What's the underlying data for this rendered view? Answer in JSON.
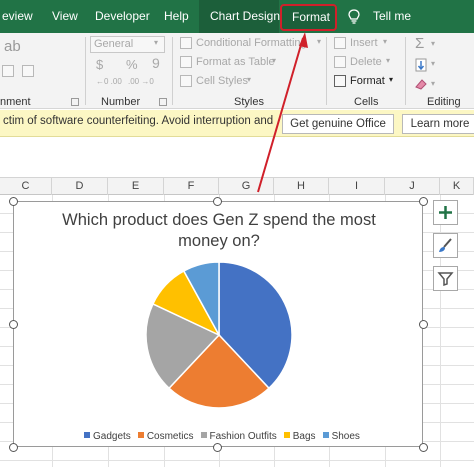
{
  "tabs": {
    "review": "eview",
    "view": "View",
    "developer": "Developer",
    "help": "Help",
    "chart_design": "Chart Design",
    "format": "Format",
    "tell_me": "Tell me"
  },
  "ribbon": {
    "number": {
      "format_select": "General",
      "currency": "$",
      "percent": "%",
      "comma": "9",
      "increase_decimal": "←0 .00",
      "decrease_decimal": ".00 →0",
      "label": "Number"
    },
    "alignment": {
      "label": "nment"
    },
    "styles": {
      "conditional_formatting": "Conditional Formatting",
      "format_as_table": "Format as Table",
      "cell_styles": "Cell Styles",
      "label": "Styles"
    },
    "cells": {
      "insert": "Insert",
      "delete": "Delete",
      "format": "Format",
      "label": "Cells"
    },
    "editing": {
      "label": "Editing"
    }
  },
  "message_bar": {
    "text": "ctim of software counterfeiting. Avoid interruption and",
    "genuine_button": "Get genuine Office",
    "learn_more_button": "Learn more"
  },
  "columns": [
    "C",
    "D",
    "E",
    "F",
    "G",
    "H",
    "I",
    "J",
    "K"
  ],
  "colors": {
    "excel_green": "#217346",
    "highlight_red": "#d0202a",
    "gadgets": "#4472c4",
    "cosmetics": "#ed7d31",
    "fashion_outfits": "#a5a5a5",
    "bags": "#ffc000",
    "shoes": "#5b9bd5"
  },
  "chart_data": {
    "type": "pie",
    "title": "Which product does Gen Z spend the most money on?",
    "categories": [
      "Gadgets",
      "Cosmetics",
      "Fashion Outfits",
      "Bags",
      "Shoes"
    ],
    "values": [
      38,
      24,
      20,
      10,
      8
    ],
    "legend": "bottom"
  },
  "side_buttons": {
    "chart_elements": "plus-icon",
    "chart_styles": "brush-icon",
    "chart_filters": "filter-icon"
  }
}
